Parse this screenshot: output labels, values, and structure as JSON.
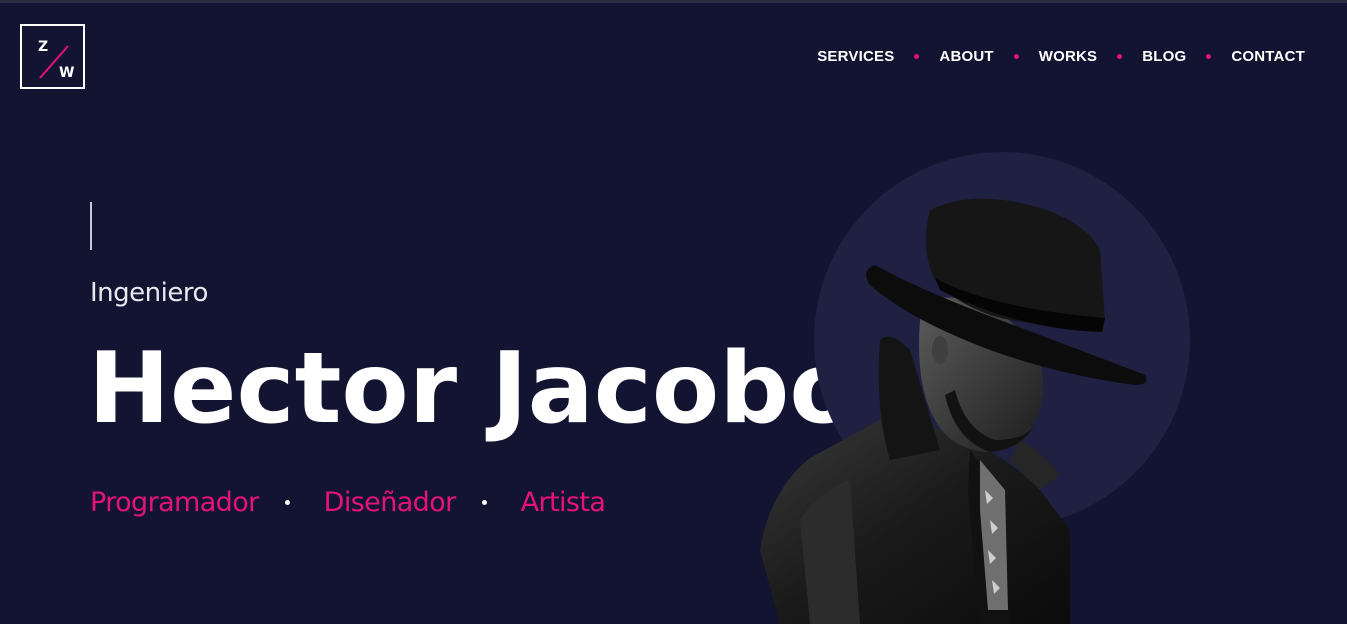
{
  "logo": {
    "top_letter": "Z",
    "bottom_letter": "W",
    "accent": "#e5127a"
  },
  "nav": {
    "items": [
      {
        "label": "SERVICES"
      },
      {
        "label": "ABOUT"
      },
      {
        "label": "WORKS"
      },
      {
        "label": "BLOG"
      },
      {
        "label": "CONTACT"
      }
    ]
  },
  "hero": {
    "subtitle": "Ingeniero",
    "name": "Hector Jacobo",
    "roles": [
      "Programador",
      "Diseñador",
      "Artista"
    ],
    "image": "portrait-man-with-hat"
  },
  "colors": {
    "background": "#131432",
    "accent": "#e5127a",
    "circle": "#1f2042",
    "text": "#ffffff"
  }
}
